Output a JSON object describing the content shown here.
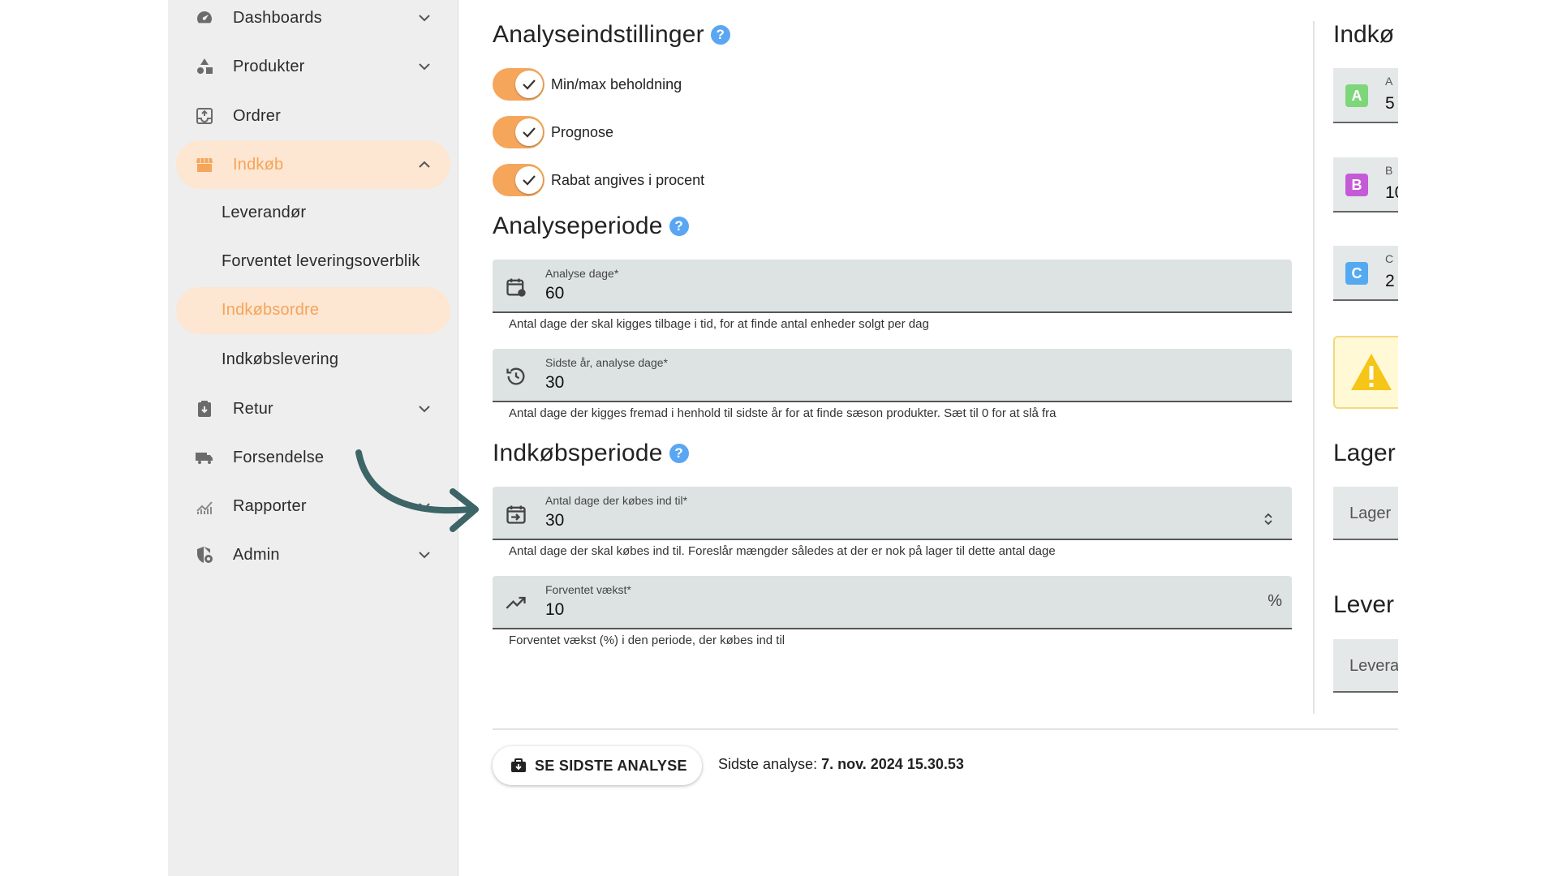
{
  "sidebar": {
    "items": [
      {
        "label": "Dashboards",
        "icon": "dashboard-icon"
      },
      {
        "label": "Produkter",
        "icon": "shapes-icon"
      },
      {
        "label": "Ordrer",
        "icon": "inbox-icon"
      },
      {
        "label": "Indkøb",
        "icon": "store-icon"
      },
      {
        "label": "Retur",
        "icon": "clipboard-return-icon"
      },
      {
        "label": "Forsendelse",
        "icon": "truck-icon"
      },
      {
        "label": "Rapporter",
        "icon": "chart-icon"
      },
      {
        "label": "Admin",
        "icon": "shield-gear-icon"
      }
    ],
    "sub_items": [
      {
        "label": "Leverandør"
      },
      {
        "label": "Forventet leveringsoverblik"
      },
      {
        "label": "Indkøbsordre"
      },
      {
        "label": "Indkøbslevering"
      }
    ]
  },
  "settings": {
    "title": "Analyseindstillinger",
    "help": "?",
    "toggles": [
      {
        "label": "Min/max beholdning",
        "on": true
      },
      {
        "label": "Prognose",
        "on": true
      },
      {
        "label": "Rabat angives i procent",
        "on": true
      }
    ]
  },
  "analysis_period": {
    "title": "Analyseperiode",
    "help": "?",
    "days_label": "Analyse dage*",
    "days_value": "60",
    "days_helper": "Antal dage der skal kigges tilbage i tid, for at finde antal enheder solgt per dag",
    "last_year_label": "Sidste år, analyse dage*",
    "last_year_value": "30",
    "last_year_helper": "Antal dage der kigges fremad i henhold til sidste år for at finde sæson produkter. Sæt til 0 for at slå fra"
  },
  "purchase_period": {
    "title": "Indkøbsperiode",
    "help": "?",
    "days_label": "Antal dage der købes ind til*",
    "days_value": "30",
    "days_helper": "Antal dage der skal købes ind til. Foreslår mængder således at der er nok på lager til dette antal dage",
    "growth_label": "Forventet vækst*",
    "growth_value": "10",
    "growth_suffix": "%",
    "growth_helper": "Forventet vækst (%) i den periode, der købes ind til"
  },
  "right_panel": {
    "title1": "Indkø",
    "cards": [
      {
        "badge": "A",
        "label": "A",
        "value": "5",
        "color": "#7dd67a"
      },
      {
        "badge": "B",
        "label": "B",
        "value": "10",
        "color": "#c45ad6"
      },
      {
        "badge": "C",
        "label": "C",
        "value": "2",
        "color": "#54aaf0"
      }
    ],
    "title2": "Lager",
    "lager_input": "Lager",
    "title3": "Lever",
    "lever_input": "Levera"
  },
  "footer": {
    "button_label": "SE SIDSTE ANALYSE",
    "last_prefix": "Sidste analyse:",
    "last_value": "7. nov. 2024 15.30.53"
  },
  "colors": {
    "accent": "#f5a65b",
    "active_bg": "#fde6d2",
    "help_blue": "#5aa6f2",
    "field_bg": "#dde3e3",
    "arrow": "#3d6466"
  }
}
